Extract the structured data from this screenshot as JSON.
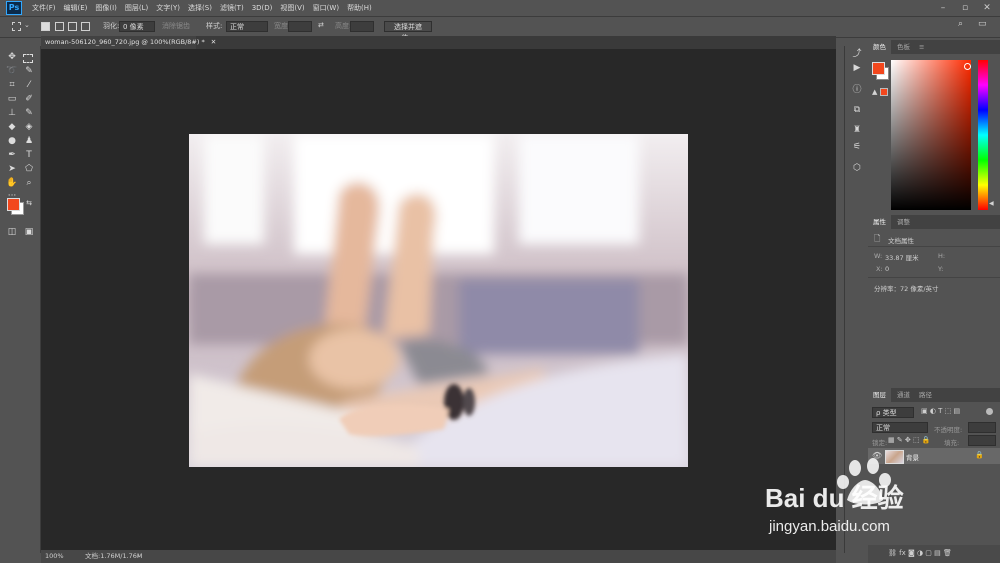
{
  "app": {
    "logo": "Ps"
  },
  "menu": [
    "文件(F)",
    "编辑(E)",
    "图像(I)",
    "图层(L)",
    "文字(Y)",
    "选择(S)",
    "滤镜(T)",
    "3D(D)",
    "视图(V)",
    "窗口(W)",
    "帮助(H)"
  ],
  "options": {
    "feather_label": "羽化:",
    "feather_value": "0 像素",
    "antialias_label": "消除锯齿",
    "style_label": "样式:",
    "style_value": "正常",
    "width_label": "宽度:",
    "height_label": "高度:",
    "select_mask_button": "选择并遮住..."
  },
  "document": {
    "tab_title": "woman-506120_960_720.jpg @ 100%(RGB/8#) *",
    "zoom": "100%",
    "doc_size": "文档:1.76M/1.76M"
  },
  "color_panel": {
    "tabs": [
      "颜色",
      "色板"
    ],
    "foreground": "#f2471d",
    "background": "#ffffff",
    "hue": "#ff2a00"
  },
  "properties_panel": {
    "tabs": [
      "属性",
      "调整"
    ],
    "title": "文档属性",
    "w_label": "W:",
    "w_value": "33.87 厘米",
    "h_label": "H:",
    "x_label": "X:",
    "x_value": "0",
    "y_label": "Y:",
    "resolution": "分辨率：72 像素/英寸"
  },
  "layers_panel": {
    "tabs": [
      "图层",
      "通道",
      "路径"
    ],
    "filter_placeholder": "ρ 类型",
    "blend_mode": "正常",
    "opacity_label": "不透明度:",
    "lock_label": "锁定:",
    "fill_label": "填充:",
    "layer_name": "背景"
  },
  "watermark": {
    "brand": "Bai du 经验",
    "url": "jingyan.baidu.com"
  }
}
